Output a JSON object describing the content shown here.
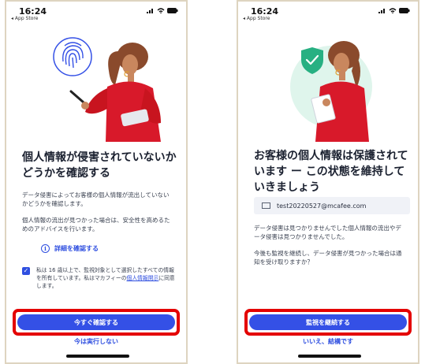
{
  "screen1": {
    "status_time": "16:24",
    "back_app": "◂ App Store",
    "title": "個人情報が侵害されていないかどうかを確認する",
    "para1": "データ侵害によってお客様の個人情報が流出していないかどうかを確認します。",
    "para2": "個人情報の流出が見つかった場合は、安全性を高めるためのアドバイスを行います。",
    "details_link": "詳細を確認する",
    "consent_prefix": "私は 16 歳以上で、監視対象として選択したすべての情報を所有しています。私はマカフィーの",
    "consent_link": "個人情報開示",
    "consent_suffix": "に同意します。",
    "primary_button": "今すぐ確認する",
    "secondary_link": "今は実行しない"
  },
  "screen2": {
    "status_time": "16:24",
    "back_app": "◂ App Store",
    "title": "お客様の個人情報は保護されています ー この状態を維持していきましょう",
    "email": "test20220527@mcafee.com",
    "para1": "データ侵害は見つかりませんでした個人情報の流出やデータ侵害は見つかりませんでした。",
    "para2": "今後も監視を継続し、データ侵害が見つかった場合は通知を受け取りますか？",
    "primary_button": "監視を継続する",
    "secondary_link": "いいえ、結構です"
  },
  "colors": {
    "accent_blue": "#3450e6",
    "highlight_red": "#e40000",
    "shield_green": "#27b082",
    "figure_red": "#d8192a"
  }
}
